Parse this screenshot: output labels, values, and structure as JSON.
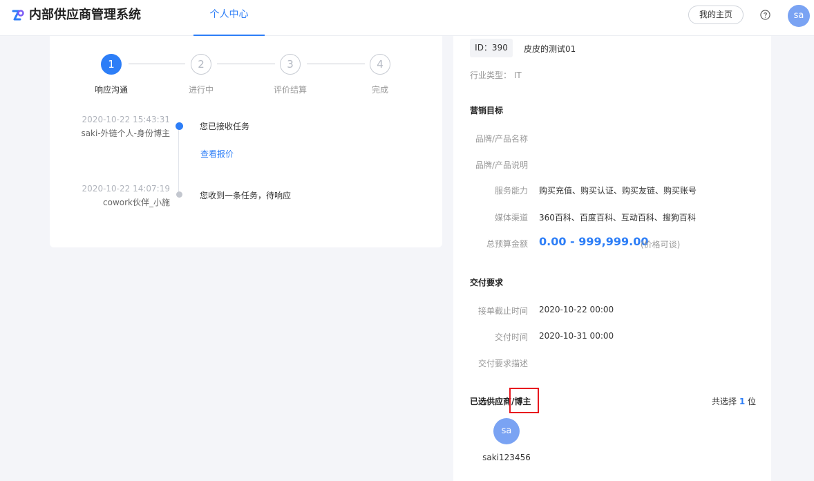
{
  "app": {
    "title": "内部供应商管理系统",
    "brand_color": "#2d7ef7"
  },
  "nav": {
    "active_tab": "个人中心"
  },
  "header": {
    "home_label": "我的主页",
    "help_icon": "question-circle-icon",
    "avatar_text": "sa"
  },
  "steps": [
    {
      "num": "1",
      "label": "响应沟通",
      "active": true
    },
    {
      "num": "2",
      "label": "进行中",
      "active": false
    },
    {
      "num": "3",
      "label": "评价结算",
      "active": false
    },
    {
      "num": "4",
      "label": "完成",
      "active": false
    }
  ],
  "timeline": [
    {
      "time": "2020-10-22 15:43:31",
      "actor": "saki-外链个人-身份博主",
      "text": "您已接收任务",
      "link": "查看报价"
    },
    {
      "time": "2020-10-22 14:07:19",
      "actor": "cowork伙伴_小施",
      "text": "您收到一条任务，待响应"
    }
  ],
  "task": {
    "id_label": "ID：390",
    "name": "皮皮的测试01",
    "industry": "行业类型：  IT"
  },
  "marketing": {
    "title": "营销目标",
    "brand_name_label": "品牌/产品名称",
    "brand_desc_label": "品牌/产品说明",
    "service_label": "服务能力",
    "service_value": "购买充值、购买认证、购买友链、购买账号",
    "media_label": "媒体渠道",
    "media_value": "360百科、百度百科、互动百科、搜狗百科",
    "budget_label": "总预算金额",
    "budget_value": "0.00 - 999,999.00",
    "budget_note": "(价格可谈)"
  },
  "delivery": {
    "title": "交付要求",
    "deadline_label": "接单截止时间",
    "deadline_value": "2020-10-22 00:00",
    "delivery_time_label": "交付时间",
    "delivery_time_value": "2020-10-31 00:00",
    "desc_label": "交付要求描述"
  },
  "selected": {
    "title": "已选供应商/博主",
    "count_prefix": "共选择",
    "count": "1",
    "count_suffix": "位",
    "supplier_avatar": "sa",
    "supplier_name": "saki123456"
  }
}
